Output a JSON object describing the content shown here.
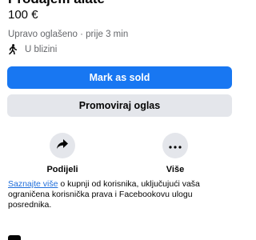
{
  "listing": {
    "title": "Prodajem alate",
    "price": "100 €",
    "meta": "Upravo oglašeno · prije 3 min",
    "location": "U blizini",
    "location_icon": "walking-person-icon"
  },
  "buttons": {
    "mark_sold": "Mark as sold",
    "promote": "Promoviraj oglas"
  },
  "actions": {
    "share": {
      "label": "Podijeli",
      "icon": "share-arrow-icon"
    },
    "more": {
      "label": "Više",
      "icon": "more-dots-icon"
    }
  },
  "info": {
    "link": "Saznajte više",
    "text": " o kupnji od korisnika, uključujući vaša ograničena korisnička prava i Facebookovu ulogu posrednika."
  },
  "colors": {
    "primary": "#1877f2",
    "secondary": "#e4e6eb",
    "link": "#216fdb",
    "muted": "#65676b"
  }
}
